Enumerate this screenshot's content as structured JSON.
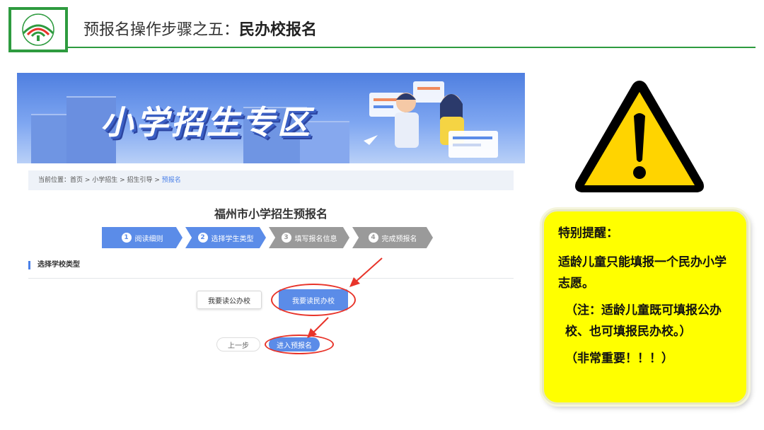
{
  "header": {
    "title_prefix": "预报名操作步骤之五：",
    "title_bold": "民办校报名",
    "accent_color": "#2e9b3f"
  },
  "screenshot": {
    "banner_title": "小学招生专区",
    "breadcrumb": {
      "prefix": "当前位置：首页 > 小学招生 > 招生引导 > ",
      "current": "预报名"
    },
    "form_title": "福州市小学招生预报名",
    "steps": [
      {
        "num": "1",
        "label": "阅读细则"
      },
      {
        "num": "2",
        "label": "选择学生类型"
      },
      {
        "num": "3",
        "label": "填写报名信息"
      },
      {
        "num": "4",
        "label": "完成预报名"
      }
    ],
    "section_title": "选择学校类型",
    "btn_public": "我要读公办校",
    "btn_private": "我要读民办校",
    "btn_prev": "上一步",
    "btn_enter": "进入预报名",
    "primary_color": "#5b8ce8",
    "highlight_color": "#e8342a"
  },
  "note": {
    "heading": "特别提醒：",
    "p1": "适龄儿童只能填报一个民办小学志愿。",
    "p2": "（注：适龄儿童既可填报公办校、也可填报民办校。）",
    "p3": "（非常重要！！！）",
    "bg_color": "#ffff00"
  }
}
